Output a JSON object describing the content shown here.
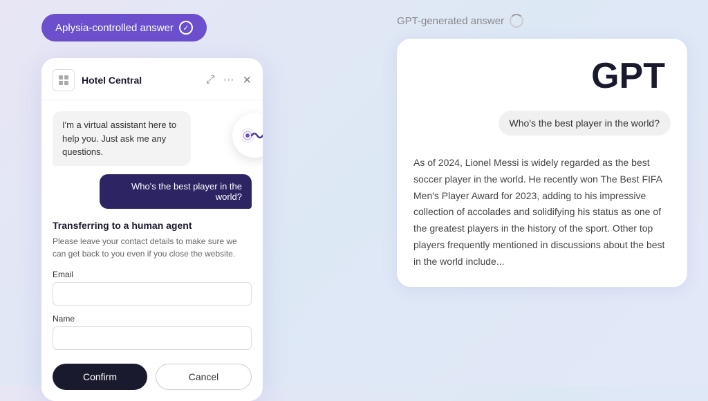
{
  "left": {
    "badge_label": "Aplysia-controlled answer",
    "chat": {
      "hotel_name": "Hotel Central",
      "bot_message": "I'm a virtual assistant here to help you. Just ask me any questions.",
      "user_message": "Who's the best player in the world?",
      "transfer_title": "Transferring to a human agent",
      "transfer_desc": "Please leave your contact details to make sure we can get back to you even if you close the website.",
      "email_label": "Email",
      "name_label": "Name",
      "confirm_label": "Confirm",
      "cancel_label": "Cancel"
    }
  },
  "right": {
    "badge_label": "GPT-generated answer",
    "gpt_title": "GPT",
    "user_message": "Who's the best player in the world?",
    "response": "As of 2024, Lionel Messi is widely regarded as the best soccer player in the world. He recently won The Best FIFA Men's Player Award for 2023, adding to his impressive collection of accolades and solidifying his status as one of the greatest players in the history of the sport. Other top players frequently mentioned in discussions about the best in the world include..."
  }
}
